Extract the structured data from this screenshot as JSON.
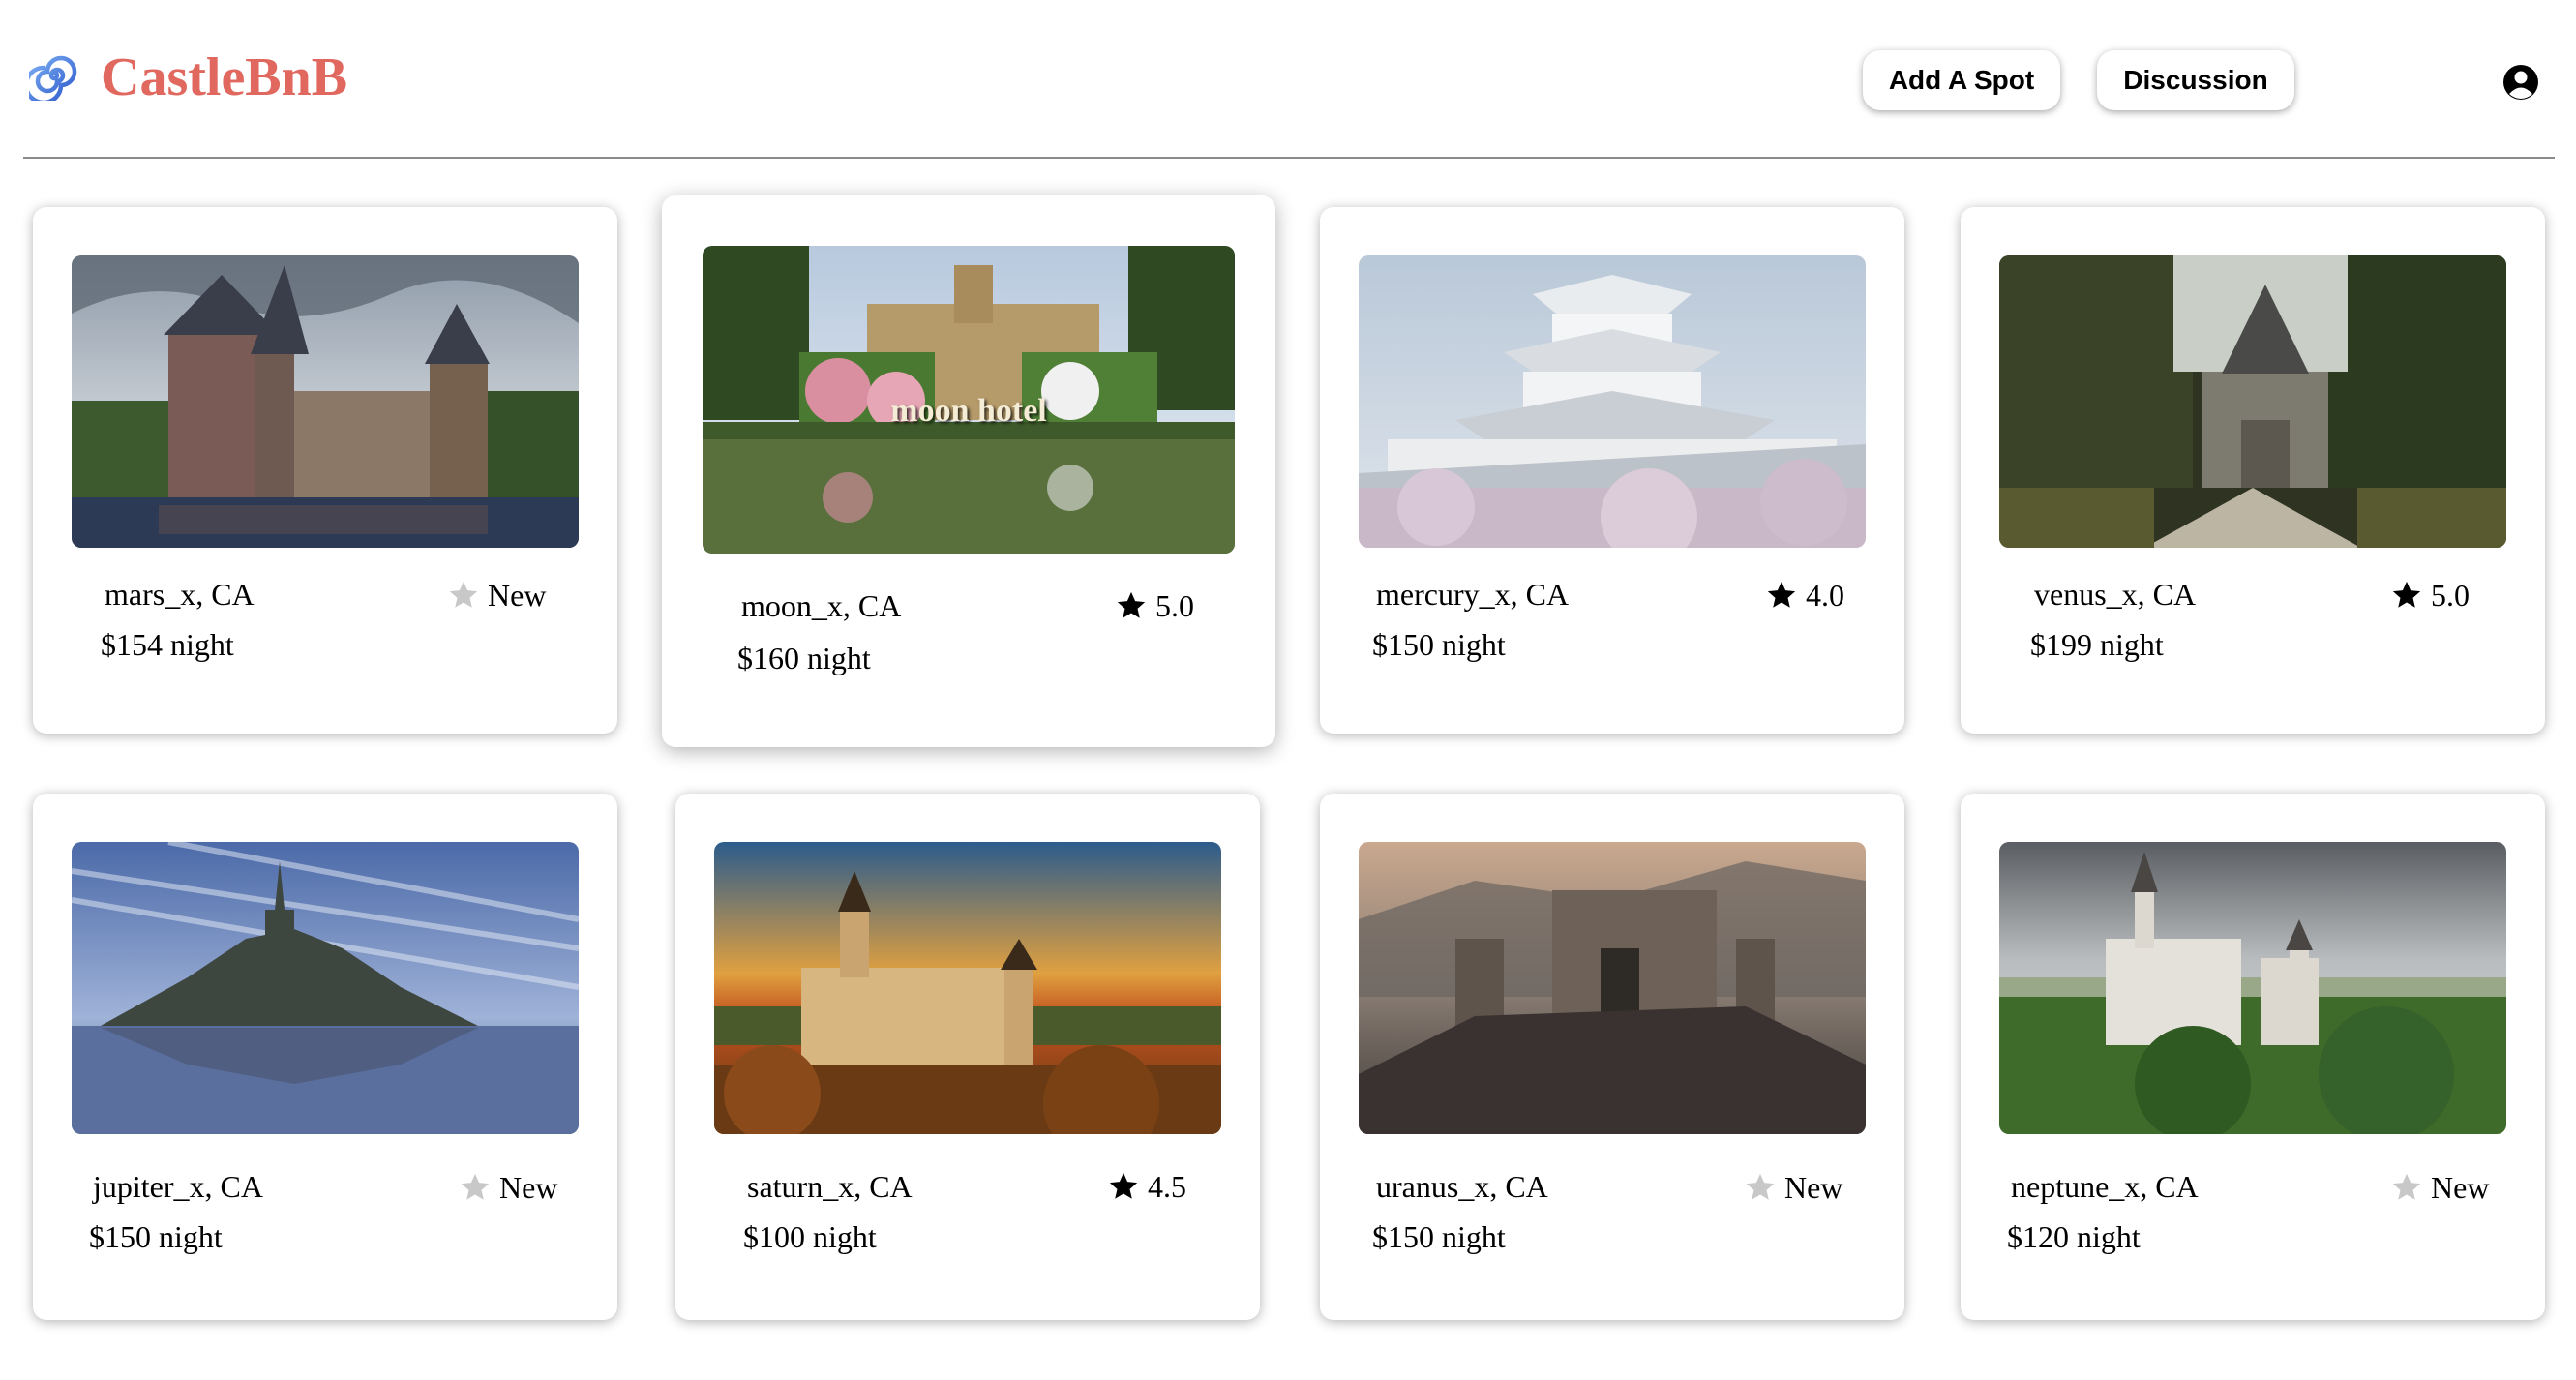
{
  "brand": {
    "name": "CastleBnB",
    "color": "#e0685f",
    "icon": "spiral-logo-icon"
  },
  "nav": {
    "add_spot": "Add A Spot",
    "discussion": "Discussion",
    "user_icon": "user-circle-icon"
  },
  "spots": [
    {
      "location": "mars_x, CA",
      "price": "$154 night",
      "rating": "New",
      "rated": false
    },
    {
      "location": "moon_x, CA",
      "price": "$160 night",
      "rating": "5.0",
      "rated": true,
      "overlay": "moon hotel"
    },
    {
      "location": "mercury_x, CA",
      "price": "$150 night",
      "rating": "4.0",
      "rated": true
    },
    {
      "location": "venus_x, CA",
      "price": "$199 night",
      "rating": "5.0",
      "rated": true
    },
    {
      "location": "jupiter_x, CA",
      "price": "$150 night",
      "rating": "New",
      "rated": false
    },
    {
      "location": "saturn_x, CA",
      "price": "$100 night",
      "rating": "4.5",
      "rated": true
    },
    {
      "location": "uranus_x, CA",
      "price": "$150 night",
      "rating": "New",
      "rated": false
    },
    {
      "location": "neptune_x, CA",
      "price": "$120 night",
      "rating": "New",
      "rated": false
    }
  ],
  "colors": {
    "star_rated": "#000000",
    "star_new": "#c8c8c8"
  }
}
